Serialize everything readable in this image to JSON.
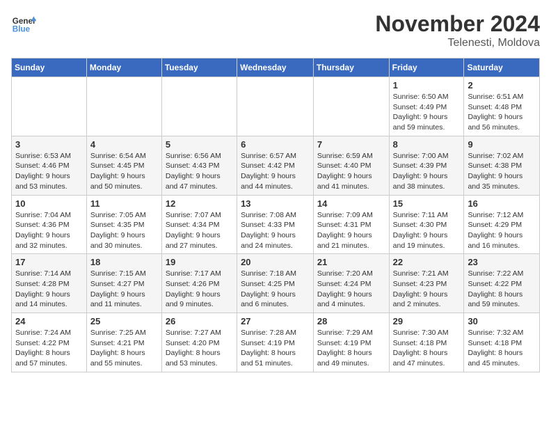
{
  "header": {
    "logo_general": "General",
    "logo_blue": "Blue",
    "month": "November 2024",
    "location": "Telenesti, Moldova"
  },
  "weekdays": [
    "Sunday",
    "Monday",
    "Tuesday",
    "Wednesday",
    "Thursday",
    "Friday",
    "Saturday"
  ],
  "weeks": [
    [
      {
        "day": "",
        "info": ""
      },
      {
        "day": "",
        "info": ""
      },
      {
        "day": "",
        "info": ""
      },
      {
        "day": "",
        "info": ""
      },
      {
        "day": "",
        "info": ""
      },
      {
        "day": "1",
        "info": "Sunrise: 6:50 AM\nSunset: 4:49 PM\nDaylight: 9 hours and 59 minutes."
      },
      {
        "day": "2",
        "info": "Sunrise: 6:51 AM\nSunset: 4:48 PM\nDaylight: 9 hours and 56 minutes."
      }
    ],
    [
      {
        "day": "3",
        "info": "Sunrise: 6:53 AM\nSunset: 4:46 PM\nDaylight: 9 hours and 53 minutes."
      },
      {
        "day": "4",
        "info": "Sunrise: 6:54 AM\nSunset: 4:45 PM\nDaylight: 9 hours and 50 minutes."
      },
      {
        "day": "5",
        "info": "Sunrise: 6:56 AM\nSunset: 4:43 PM\nDaylight: 9 hours and 47 minutes."
      },
      {
        "day": "6",
        "info": "Sunrise: 6:57 AM\nSunset: 4:42 PM\nDaylight: 9 hours and 44 minutes."
      },
      {
        "day": "7",
        "info": "Sunrise: 6:59 AM\nSunset: 4:40 PM\nDaylight: 9 hours and 41 minutes."
      },
      {
        "day": "8",
        "info": "Sunrise: 7:00 AM\nSunset: 4:39 PM\nDaylight: 9 hours and 38 minutes."
      },
      {
        "day": "9",
        "info": "Sunrise: 7:02 AM\nSunset: 4:38 PM\nDaylight: 9 hours and 35 minutes."
      }
    ],
    [
      {
        "day": "10",
        "info": "Sunrise: 7:04 AM\nSunset: 4:36 PM\nDaylight: 9 hours and 32 minutes."
      },
      {
        "day": "11",
        "info": "Sunrise: 7:05 AM\nSunset: 4:35 PM\nDaylight: 9 hours and 30 minutes."
      },
      {
        "day": "12",
        "info": "Sunrise: 7:07 AM\nSunset: 4:34 PM\nDaylight: 9 hours and 27 minutes."
      },
      {
        "day": "13",
        "info": "Sunrise: 7:08 AM\nSunset: 4:33 PM\nDaylight: 9 hours and 24 minutes."
      },
      {
        "day": "14",
        "info": "Sunrise: 7:09 AM\nSunset: 4:31 PM\nDaylight: 9 hours and 21 minutes."
      },
      {
        "day": "15",
        "info": "Sunrise: 7:11 AM\nSunset: 4:30 PM\nDaylight: 9 hours and 19 minutes."
      },
      {
        "day": "16",
        "info": "Sunrise: 7:12 AM\nSunset: 4:29 PM\nDaylight: 9 hours and 16 minutes."
      }
    ],
    [
      {
        "day": "17",
        "info": "Sunrise: 7:14 AM\nSunset: 4:28 PM\nDaylight: 9 hours and 14 minutes."
      },
      {
        "day": "18",
        "info": "Sunrise: 7:15 AM\nSunset: 4:27 PM\nDaylight: 9 hours and 11 minutes."
      },
      {
        "day": "19",
        "info": "Sunrise: 7:17 AM\nSunset: 4:26 PM\nDaylight: 9 hours and 9 minutes."
      },
      {
        "day": "20",
        "info": "Sunrise: 7:18 AM\nSunset: 4:25 PM\nDaylight: 9 hours and 6 minutes."
      },
      {
        "day": "21",
        "info": "Sunrise: 7:20 AM\nSunset: 4:24 PM\nDaylight: 9 hours and 4 minutes."
      },
      {
        "day": "22",
        "info": "Sunrise: 7:21 AM\nSunset: 4:23 PM\nDaylight: 9 hours and 2 minutes."
      },
      {
        "day": "23",
        "info": "Sunrise: 7:22 AM\nSunset: 4:22 PM\nDaylight: 8 hours and 59 minutes."
      }
    ],
    [
      {
        "day": "24",
        "info": "Sunrise: 7:24 AM\nSunset: 4:22 PM\nDaylight: 8 hours and 57 minutes."
      },
      {
        "day": "25",
        "info": "Sunrise: 7:25 AM\nSunset: 4:21 PM\nDaylight: 8 hours and 55 minutes."
      },
      {
        "day": "26",
        "info": "Sunrise: 7:27 AM\nSunset: 4:20 PM\nDaylight: 8 hours and 53 minutes."
      },
      {
        "day": "27",
        "info": "Sunrise: 7:28 AM\nSunset: 4:19 PM\nDaylight: 8 hours and 51 minutes."
      },
      {
        "day": "28",
        "info": "Sunrise: 7:29 AM\nSunset: 4:19 PM\nDaylight: 8 hours and 49 minutes."
      },
      {
        "day": "29",
        "info": "Sunrise: 7:30 AM\nSunset: 4:18 PM\nDaylight: 8 hours and 47 minutes."
      },
      {
        "day": "30",
        "info": "Sunrise: 7:32 AM\nSunset: 4:18 PM\nDaylight: 8 hours and 45 minutes."
      }
    ]
  ]
}
